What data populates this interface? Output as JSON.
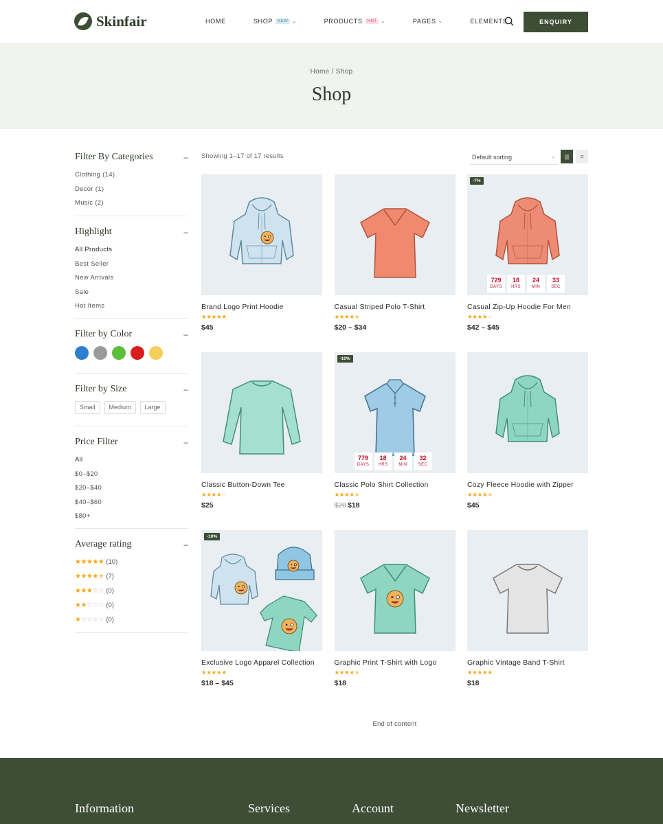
{
  "brand": {
    "name": "Skinfair"
  },
  "nav": {
    "items": [
      {
        "label": "HOME",
        "badge": ""
      },
      {
        "label": "SHOP",
        "badge": "NEW"
      },
      {
        "label": "PRODUCTS",
        "badge": "HOT"
      },
      {
        "label": "PAGES",
        "badge": ""
      },
      {
        "label": "ELEMENTS",
        "badge": ""
      }
    ],
    "enquiry_label": "ENQUIRY"
  },
  "banner": {
    "breadcrumb": "Home / Shop",
    "title": "Shop"
  },
  "sidebar": {
    "categories": {
      "title": "Filter By Categories",
      "toggle": "–",
      "items": [
        "Clothing (14)",
        "Decor (1)",
        "Music (2)"
      ]
    },
    "highlight": {
      "title": "Highlight",
      "toggle": "–",
      "items": [
        "All Products",
        "Best Seller",
        "New Arrivals",
        "Sale",
        "Hot Items"
      ]
    },
    "color": {
      "title": "Filter by Color",
      "toggle": "–",
      "swatches": [
        "#2f7fcf",
        "#9a9a9a",
        "#5bbf3a",
        "#d81e1e",
        "#f4cf5c"
      ]
    },
    "size": {
      "title": "Filter by Size",
      "toggle": "–",
      "items": [
        "Small",
        "Medium",
        "Large"
      ]
    },
    "price": {
      "title": "Price Filter",
      "toggle": "–",
      "items": [
        "All",
        "$0–$20",
        "$20–$40",
        "$40–$60",
        "$80+"
      ]
    },
    "rating": {
      "title": "Average rating",
      "toggle": "–",
      "rows": [
        {
          "stars": 5,
          "count": "(10)"
        },
        {
          "stars": 4.5,
          "count": "(7)"
        },
        {
          "stars": 3,
          "count": "(0)"
        },
        {
          "stars": 2,
          "count": "(0)"
        },
        {
          "stars": 1,
          "count": "(0)"
        }
      ]
    }
  },
  "toolbar": {
    "results": "Showing 1–17 of 17 results",
    "sort": "Default sorting"
  },
  "countdown_labels": [
    "DAYS",
    "HRS",
    "MIN",
    "SEC"
  ],
  "products": [
    {
      "name": "Brand Logo Print Hoodie",
      "rating": 5,
      "price": "$45",
      "old_price": "",
      "badge": "",
      "countdown": null,
      "image": "hoodie",
      "color": "#cfe3ee",
      "stroke": "#5c8aa3",
      "logo": true
    },
    {
      "name": "Casual Striped Polo T-Shirt",
      "rating": 4.5,
      "price": "$20 – $34",
      "old_price": "",
      "badge": "",
      "countdown": null,
      "image": "vneck",
      "color": "#ef8a6f",
      "stroke": "#b4523c",
      "logo": false
    },
    {
      "name": "Casual Zip-Up Hoodie For Men",
      "rating": 4,
      "price": "$42 – $45",
      "old_price": "",
      "badge": "-7%",
      "countdown": [
        "729",
        "18",
        "24",
        "33"
      ],
      "image": "hoodie",
      "color": "#ee8b74",
      "stroke": "#b4523c",
      "logo": false
    },
    {
      "name": "Classic Button-Down Tee",
      "rating": 4,
      "price": "$25",
      "old_price": "",
      "badge": "",
      "countdown": null,
      "image": "longsleeve",
      "color": "#a5e0cf",
      "stroke": "#3f8f7a",
      "logo": false
    },
    {
      "name": "Classic Polo Shirt Collection",
      "rating": 4.5,
      "price": "$18",
      "old_price": "$20",
      "badge": "-10%",
      "countdown": [
        "779",
        "18",
        "24",
        "32"
      ],
      "image": "polo",
      "color": "#9fcbe6",
      "stroke": "#3e6f92",
      "logo": false
    },
    {
      "name": "Cozy Fleece Hoodie with Zipper",
      "rating": 4.5,
      "price": "$45",
      "old_price": "",
      "badge": "",
      "countdown": null,
      "image": "hoodie",
      "color": "#8fd6c0",
      "stroke": "#3f8f7a",
      "logo": false
    },
    {
      "name": "Exclusive Logo Apparel Collection",
      "rating": 5,
      "price": "$18 – $45",
      "old_price": "",
      "badge": "-10%",
      "countdown": null,
      "image": "bundle",
      "color": "#cfe3ee",
      "stroke": "#5c8aa3",
      "logo": true
    },
    {
      "name": "Graphic Print T-Shirt with Logo",
      "rating": 4.5,
      "price": "$18",
      "old_price": "",
      "badge": "",
      "countdown": null,
      "image": "vneck",
      "color": "#8fd6c0",
      "stroke": "#3f8f7a",
      "logo": true
    },
    {
      "name": "Graphic Vintage Band T-Shirt",
      "rating": 5,
      "price": "$18",
      "old_price": "",
      "badge": "",
      "countdown": null,
      "image": "tee",
      "color": "#e4e4e4",
      "stroke": "#777777",
      "logo": false
    }
  ],
  "end_message": "End of content",
  "footer": {
    "columns": [
      "Information",
      "Services",
      "Account",
      "Newsletter"
    ]
  }
}
